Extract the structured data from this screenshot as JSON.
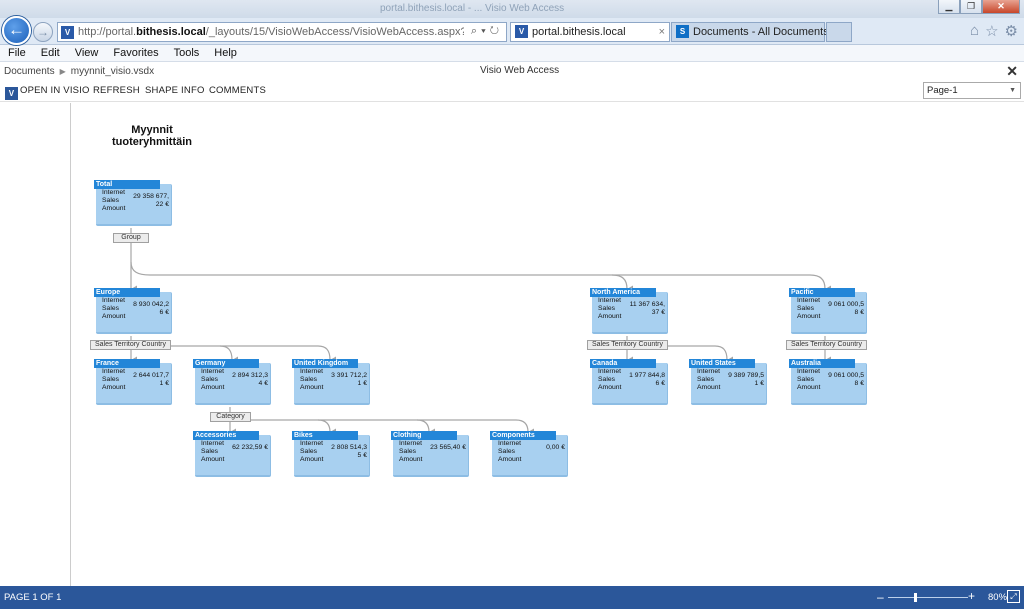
{
  "browser": {
    "title": "portal.bithesis.local - ... Visio Web Access",
    "url_prefix": "http://portal.",
    "url_domain": "bithesis.local",
    "url_rest": "/_layouts/15/VisioWebAccess/VisioWebAccess.aspx?id=/Documents/myynnit_visio.vsdx",
    "tabs": [
      {
        "label": "portal.bithesis.local",
        "close": "×"
      },
      {
        "label": "Documents - All Documents"
      }
    ],
    "menu": [
      "File",
      "Edit",
      "View",
      "Favorites",
      "Tools",
      "Help"
    ]
  },
  "vwa": {
    "breadcrumb": [
      "Documents",
      "myynnit_visio.vsdx"
    ],
    "title": "Visio Web Access",
    "toolbar": {
      "open_in_visio": "OPEN IN VISIO",
      "refresh": "REFRESH",
      "shape_info": "SHAPE INFO",
      "comments": "COMMENTS"
    },
    "page_select": "Page-1"
  },
  "diagram": {
    "title_line1": "Myynnit",
    "title_line2": "tuoteryhmittäin",
    "measure_label_1": "Internet",
    "measure_label_2": "Sales",
    "measure_label_3": "Amount",
    "nodes": {
      "total": {
        "name": "Total",
        "value1": "29 358 677,",
        "value2": "22 €"
      },
      "europe": {
        "name": "Europe",
        "value1": "8 930 042,2",
        "value2": "6 €"
      },
      "north_america": {
        "name": "North America",
        "value1": "11 367 634,",
        "value2": "37 €"
      },
      "pacific": {
        "name": "Pacific",
        "value1": "9 061 000,5",
        "value2": "8 €"
      },
      "france": {
        "name": "France",
        "value1": "2 644 017,7",
        "value2": "1 €"
      },
      "germany": {
        "name": "Germany",
        "value1": "2 894 312,3",
        "value2": "4 €"
      },
      "uk": {
        "name": "United Kingdom",
        "value1": "3 391 712,2",
        "value2": "1 €"
      },
      "canada": {
        "name": "Canada",
        "value1": "1 977 844,8",
        "value2": "6 €"
      },
      "us": {
        "name": "United States",
        "value1": "9 389 789,5",
        "value2": "1 €"
      },
      "australia": {
        "name": "Australia",
        "value1": "9 061 000,5",
        "value2": "8 €"
      },
      "accessories": {
        "name": "Accessories",
        "value1": "62 232,59 €",
        "value2": ""
      },
      "bikes": {
        "name": "Bikes",
        "value1": "2 808 514,3",
        "value2": "5 €"
      },
      "clothing": {
        "name": "Clothing",
        "value1": "23 565,40 €",
        "value2": ""
      },
      "components": {
        "name": "Components",
        "value1": "0,00 €",
        "value2": ""
      }
    },
    "group_labels": {
      "group": "Group",
      "stc_europe": "Sales Territory Country",
      "stc_na": "Sales Territory Country",
      "stc_pacific": "Sales Territory Country",
      "category": "Category"
    }
  },
  "status": {
    "page": "PAGE 1 OF 1",
    "zoom": "80%",
    "zoom_level_percent": 80
  },
  "colors": {
    "node_header": "#2386d8",
    "node_body": "#a8d0f0",
    "status_bar": "#2b579a",
    "connector": "#a6a6a6"
  }
}
